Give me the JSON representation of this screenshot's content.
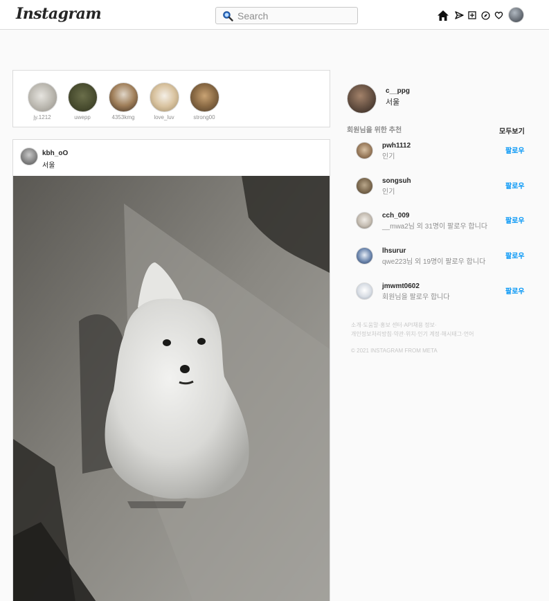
{
  "header": {
    "logo": "Instagram",
    "search_placeholder": "Search",
    "icons": [
      "home-icon",
      "direct-icon",
      "new-post-icon",
      "explore-icon",
      "activity-icon"
    ]
  },
  "stories": [
    {
      "name": "jy.1212",
      "color": "#c9c6c0"
    },
    {
      "name": "uwepp",
      "color": "#4e5336"
    },
    {
      "name": "4353kmg",
      "color": "#7d6548"
    },
    {
      "name": "love_luv",
      "color": "#d8c6a4"
    },
    {
      "name": "strong00",
      "color": "#8b6f4e"
    }
  ],
  "post": {
    "username": "kbh_oO",
    "location": "서울"
  },
  "profile": {
    "username": "c__ppg",
    "location": "서울"
  },
  "recommendations": {
    "title": "회원님을 위한 추천",
    "see_all": "모두보기",
    "items": [
      {
        "username": "pwh1112",
        "subtitle": "인기",
        "follow": "팔로우"
      },
      {
        "username": "songsuh",
        "subtitle": "인기",
        "follow": "팔로우"
      },
      {
        "username": "cch_009",
        "subtitle": "__mwa2님 외 31명이 팔로우 합니다",
        "follow": "팔로우"
      },
      {
        "username": "lhsurur",
        "subtitle": "qwe223님 외 19명이 팔로우 합니다",
        "follow": "팔로우"
      },
      {
        "username": "jmwmt0602",
        "subtitle": "회원님을 팔로우 합니다",
        "follow": "팔로우"
      }
    ]
  },
  "footer": {
    "links_line1": "소개·도움말·홍보 센터·API채용 정보·",
    "links_line2": "개인정보처리방침·약관·위치·인기 계정·해시태그·언어",
    "copyright": "© 2021 INSTAGRAM FROM META"
  }
}
